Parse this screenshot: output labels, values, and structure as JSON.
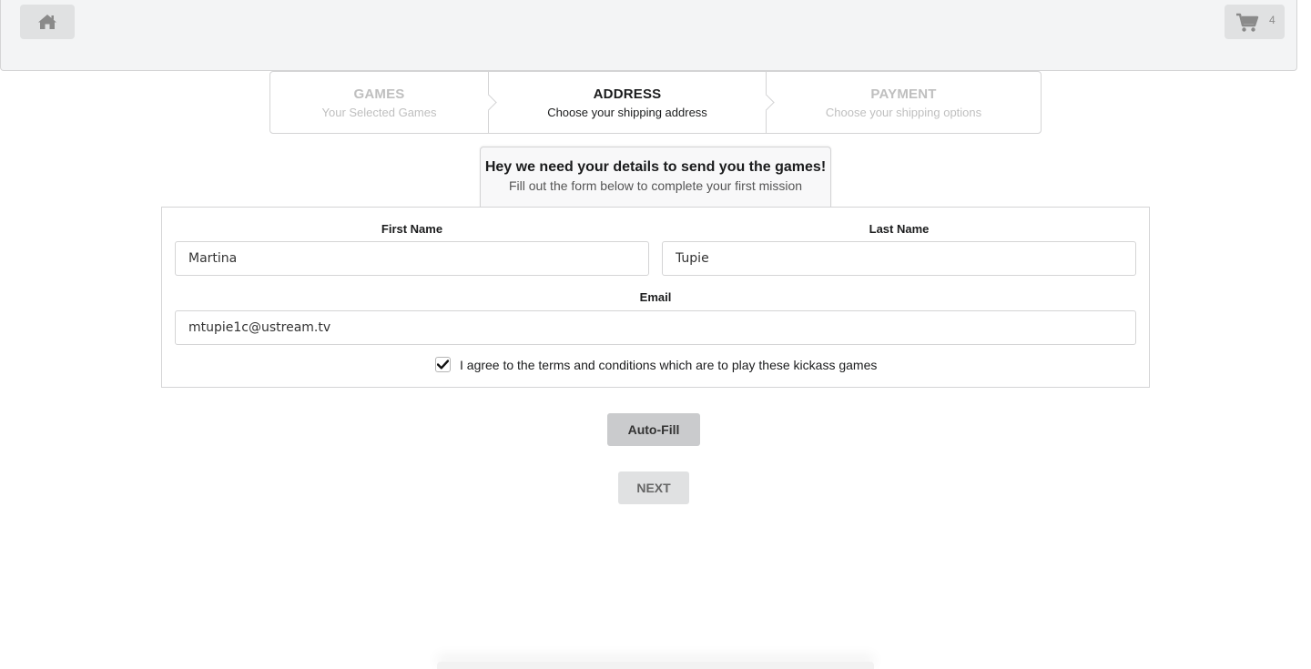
{
  "header": {
    "home_icon": "home-icon",
    "cart_icon": "cart-icon",
    "cart_count": "4"
  },
  "steps": [
    {
      "title": "GAMES",
      "description": "Your Selected Games",
      "state": "disabled"
    },
    {
      "title": "ADDRESS",
      "description": "Choose your shipping address",
      "state": "active"
    },
    {
      "title": "PAYMENT",
      "description": "Choose your shipping options",
      "state": "disabled"
    }
  ],
  "notice": {
    "title": "Hey we need your details to send you the games!",
    "subtitle": "Fill out the form below to complete your first mission"
  },
  "form": {
    "first_name": {
      "label": "First Name",
      "value": "Martina"
    },
    "last_name": {
      "label": "Last Name",
      "value": "Tupie"
    },
    "email": {
      "label": "Email",
      "value": "mtupie1c@ustream.tv"
    },
    "agree": {
      "label": "I agree to the terms and conditions which are to play these kickass games",
      "checked": true
    }
  },
  "buttons": {
    "autofill_label": "Auto-Fill",
    "next_label": "NEXT"
  },
  "colors": {
    "menu_bg": "#f3f4f5",
    "button_grey": "#e0e1e2",
    "autofill_grey": "#cacbcd",
    "disabled_text": "#bfbfbf"
  }
}
